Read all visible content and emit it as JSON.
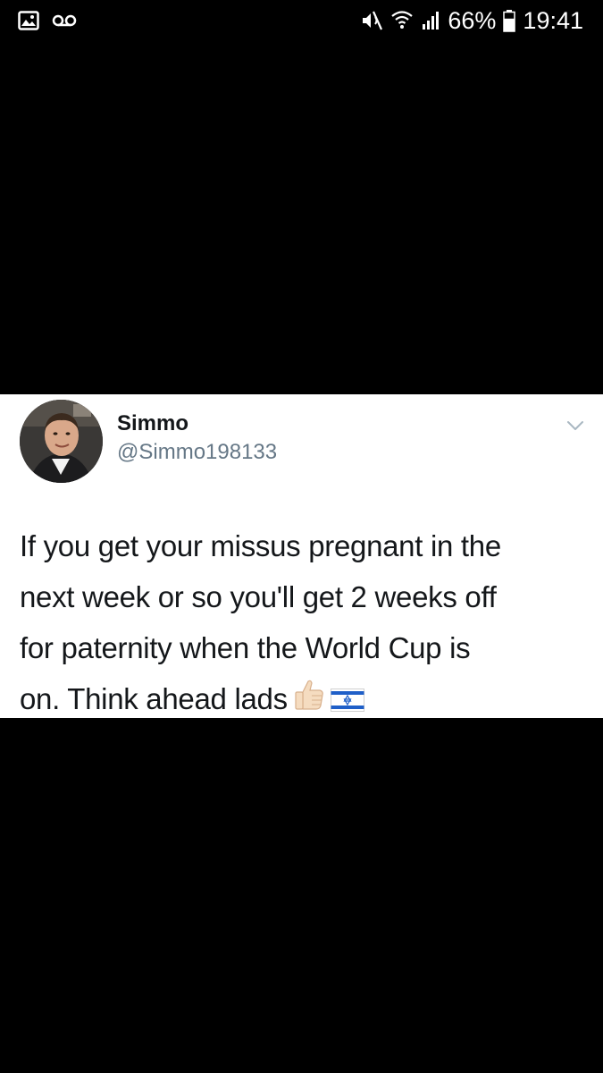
{
  "status_bar": {
    "left_icons": [
      "gallery-icon",
      "voicemail-icon"
    ],
    "right_icons": [
      "mute-icon",
      "wifi-icon",
      "signal-icon",
      "battery-icon"
    ],
    "battery_percent": "66%",
    "time": "19:41"
  },
  "tweet": {
    "display_name": "Simmo",
    "handle": "@Simmo198133",
    "text_lines": [
      "If you get your missus pregnant in the",
      "next week or so you'll get 2 weeks off",
      "for paternity when the World Cup is",
      "on. Think ahead lads"
    ],
    "emojis": [
      "thumbs-up-icon",
      "israel-flag-icon"
    ]
  }
}
